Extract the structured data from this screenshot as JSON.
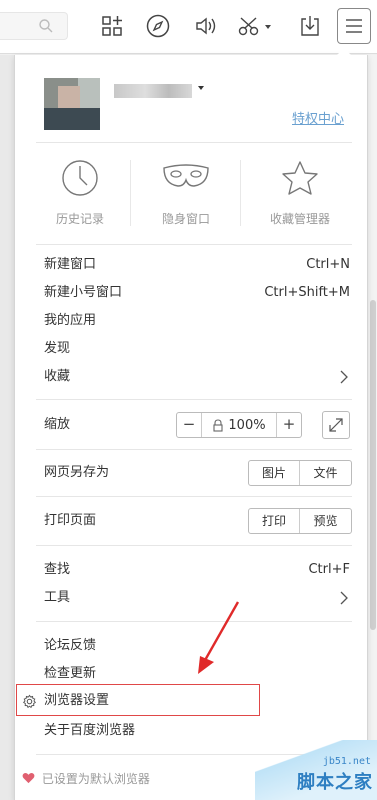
{
  "toolbar": {
    "search_icon": "search-icon",
    "icons": [
      "apps-grid-icon",
      "compass-icon",
      "sound-icon",
      "scissors-icon",
      "download-icon",
      "menu-icon"
    ]
  },
  "user": {
    "privilege_link": "特权中心"
  },
  "features": [
    {
      "label": "历史记录",
      "icon": "clock-icon"
    },
    {
      "label": "隐身窗口",
      "icon": "mask-icon"
    },
    {
      "label": "收藏管理器",
      "icon": "star-icon"
    }
  ],
  "menu": {
    "new_window": {
      "label": "新建窗口",
      "shortcut": "Ctrl+N"
    },
    "new_small_window": {
      "label": "新建小号窗口",
      "shortcut": "Ctrl+Shift+M"
    },
    "my_apps": "我的应用",
    "discover": "发现",
    "favorites": "收藏",
    "zoom": {
      "label": "缩放",
      "minus": "−",
      "value": "100%",
      "plus": "+"
    },
    "save_as": {
      "label": "网页另存为",
      "image": "图片",
      "file": "文件"
    },
    "print": {
      "label": "打印页面",
      "print": "打印",
      "preview": "预览"
    },
    "find": {
      "label": "查找",
      "shortcut": "Ctrl+F"
    },
    "tools": "工具",
    "feedback": "论坛反馈",
    "check_update": "检查更新",
    "settings": "浏览器设置",
    "about": "关于百度浏览器",
    "default_browser": "已设置为默认浏览器"
  },
  "watermark": {
    "small": "jb51.net",
    "big": "脚本之家"
  },
  "colors": {
    "accent_link": "#6aa0d0",
    "highlight": "#e04848",
    "heart": "#e06070",
    "annotation_arrow": "#e02a2a"
  }
}
